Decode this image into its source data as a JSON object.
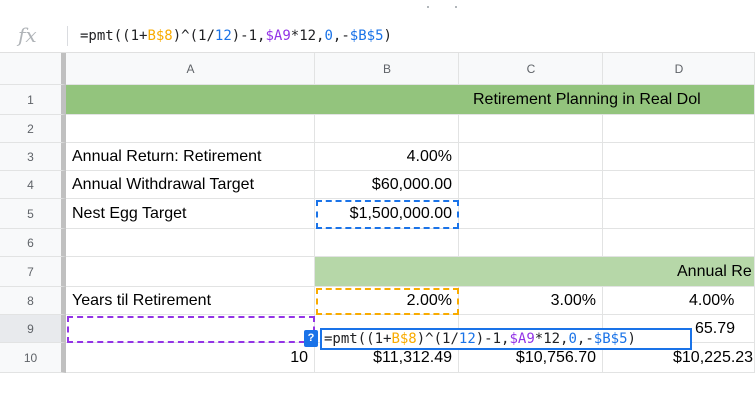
{
  "formula_bar": {
    "fx_label": "fx",
    "segments": [
      {
        "text": "=pmt((1+",
        "color": "#202124"
      },
      {
        "text": "B$8",
        "color": "#f9ab00"
      },
      {
        "text": ")^(1/",
        "color": "#202124"
      },
      {
        "text": "12",
        "color": "#1a73e8"
      },
      {
        "text": ")-1,",
        "color": "#202124"
      },
      {
        "text": "$A9",
        "color": "#9334e6"
      },
      {
        "text": "*12,",
        "color": "#202124"
      },
      {
        "text": "0",
        "color": "#1a73e8"
      },
      {
        "text": ",-",
        "color": "#202124"
      },
      {
        "text": "$B$5",
        "color": "#1a73e8"
      },
      {
        "text": ")",
        "color": "#202124"
      }
    ]
  },
  "columns": [
    "A",
    "B",
    "C",
    "D"
  ],
  "rows": [
    "1",
    "2",
    "3",
    "4",
    "5",
    "6",
    "7",
    "8",
    "9",
    "10"
  ],
  "cells": {
    "r1_title": "Retirement Planning in Real Dol",
    "a3": "Annual Return: Retirement",
    "b3": "4.00%",
    "a4": "Annual Withdrawal Target",
    "b4": "$60,000.00",
    "a5": "Nest Egg Target",
    "b5": "$1,500,000.00",
    "r7_title": "Annual Re",
    "a8": "Years til Retirement",
    "b8": "2.00%",
    "c8": "3.00%",
    "d8": "4.00%",
    "d9_partial": "65.79",
    "a10": "10",
    "b10": "$11,312.49",
    "c10": "$10,756.70",
    "d10": "$10,225.23"
  },
  "editor": {
    "help_label": "?",
    "segments": [
      {
        "text": "=pmt((1+",
        "color": "#202124"
      },
      {
        "text": "B$8",
        "color": "#f9ab00"
      },
      {
        "text": ")^(1/",
        "color": "#202124"
      },
      {
        "text": "12",
        "color": "#1a73e8"
      },
      {
        "text": ")-1,",
        "color": "#202124"
      },
      {
        "text": "$A9",
        "color": "#9334e6"
      },
      {
        "text": "*12,",
        "color": "#202124"
      },
      {
        "text": "0",
        "color": "#1a73e8"
      },
      {
        "text": ",-",
        "color": "#202124"
      },
      {
        "text": "$B$5",
        "color": "#1a73e8"
      },
      {
        "text": ")",
        "color": "#202124"
      }
    ]
  },
  "colors": {
    "green_title": "#93c47d",
    "green_section": "#b6d7a8",
    "ref_blue": "#1a73e8",
    "ref_orange": "#f9ab00",
    "ref_purple": "#9334e6"
  }
}
